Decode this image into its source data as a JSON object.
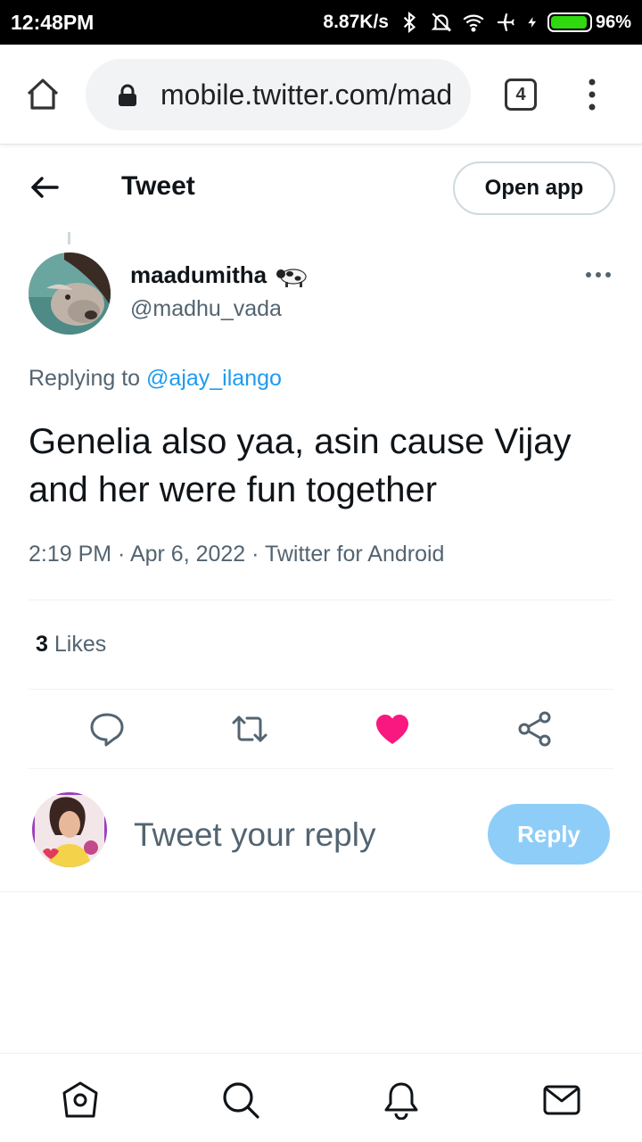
{
  "status_bar": {
    "time": "12:48PM",
    "net_speed": "8.87K/s",
    "icons": [
      "bluetooth-icon",
      "mute-icon",
      "wifi-icon",
      "airplane-icon",
      "charging-icon"
    ],
    "battery_percent": "96%",
    "battery_level": 0.96,
    "battery_color": "#2fd80f"
  },
  "browser": {
    "url": "mobile.twitter.com/madhu_vada",
    "tabs_count": "4"
  },
  "header": {
    "title": "Tweet",
    "open_app_label": "Open app"
  },
  "tweet": {
    "author_name": "maadumitha",
    "author_emoji": "cow-icon",
    "author_handle": "@madhu_vada",
    "replying_prefix": "Replying to",
    "replying_to": "@ajay_ilango",
    "text": "Genelia also yaa, asin cause Vijay and her were fun together",
    "timestamp": "2:19 PM · Apr 6, 2022 · Twitter for Android",
    "likes_count": "3",
    "likes_label": "Likes",
    "liked": true,
    "like_color": "#f91880"
  },
  "actions": [
    "reply-icon",
    "retweet-icon",
    "like-icon",
    "share-icon"
  ],
  "composer": {
    "placeholder": "Tweet your reply",
    "reply_label": "Reply",
    "reply_button_color": "#8ecdf8"
  },
  "bottom_nav": [
    "home-icon",
    "search-icon",
    "notifications-icon",
    "messages-icon"
  ],
  "colors": {
    "accent": "#1d9bf0",
    "secondary_text": "#536471",
    "primary_text": "#0f1419"
  }
}
